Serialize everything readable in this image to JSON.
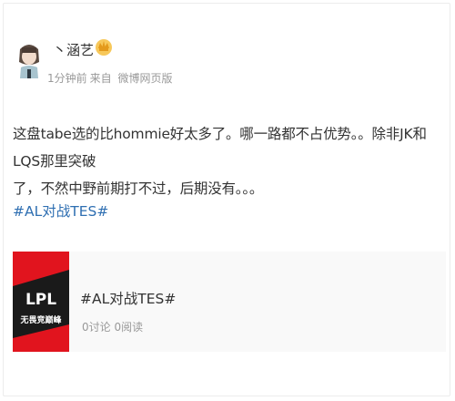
{
  "post": {
    "user_name": "丶涵艺",
    "meta": {
      "time": "1分钟前",
      "source_prefix": "来自",
      "source": "微博网页版"
    },
    "text_line1": "这盘tabe选的比hommie好太多了。哪一路都不占优势。。除非JK和LQS那里突破",
    "text_line2": "了，不然中野前期打不过，后期没有。。。",
    "hashtag": "#AL对战TES#"
  },
  "card": {
    "logo_text": "LPL",
    "logo_sub": "无畏竞巅峰",
    "title": "#AL对战TES#",
    "stats": "0讨论 0阅读"
  },
  "colors": {
    "link": "#2f6fb2",
    "meta": "#999999",
    "lpl_red": "#e1141e"
  }
}
